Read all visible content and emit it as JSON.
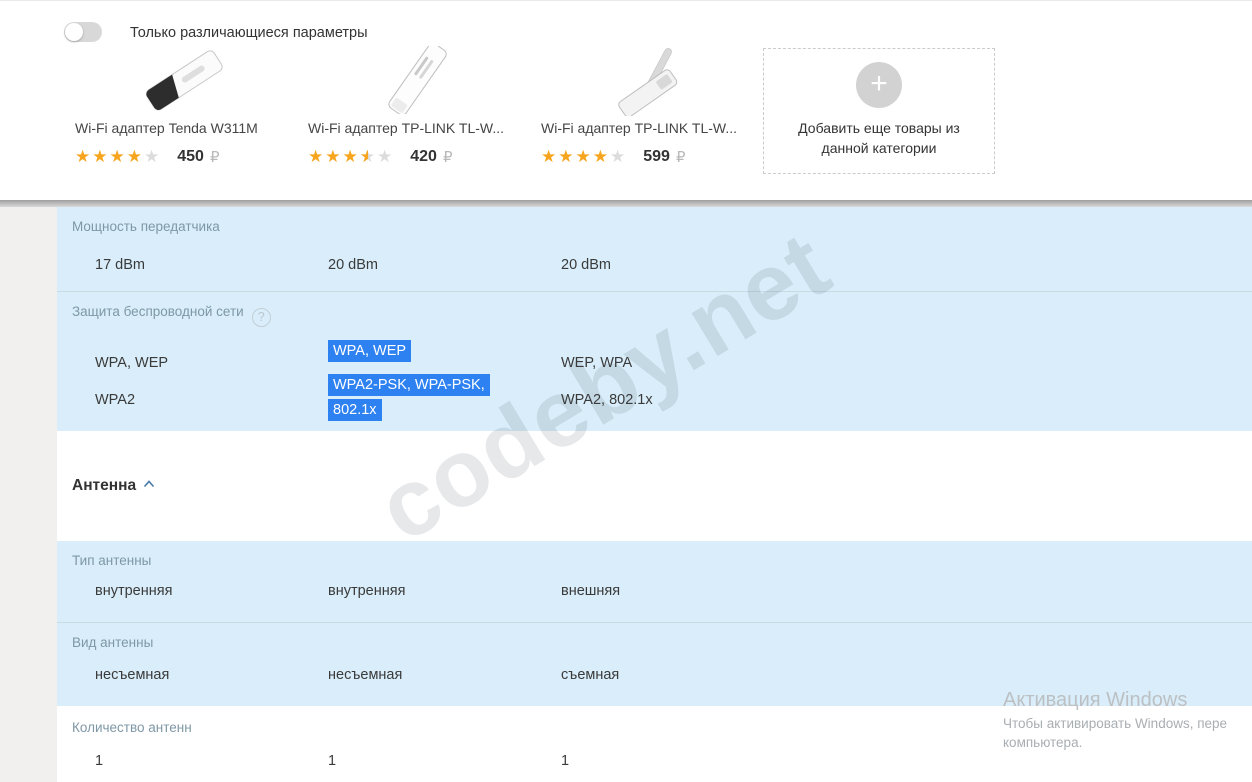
{
  "header": {
    "toggle_label": "Только различающиеся параметры",
    "products": [
      {
        "name": "Wi-Fi адаптер Tenda W311M",
        "rating": 4,
        "price": "450",
        "currency": "₽"
      },
      {
        "name": "Wi-Fi адаптер TP-LINK TL-W...",
        "rating": 3.5,
        "price": "420",
        "currency": "₽"
      },
      {
        "name": "Wi-Fi адаптер TP-LINK TL-W...",
        "rating": 4,
        "price": "599",
        "currency": "₽"
      }
    ],
    "add_more": {
      "label": "Добавить еще товары из данной категории",
      "plus": "+"
    }
  },
  "comparison": {
    "rows": [
      {
        "label": "Мощность передатчика",
        "cells": [
          [
            "17 dBm"
          ],
          [
            "20 dBm"
          ],
          [
            "20 dBm"
          ]
        ]
      },
      {
        "label": "Защита беспроводной сети",
        "help": "?",
        "cells": [
          [
            "WPA, WEP",
            "WPA2"
          ],
          [
            "WPA, WEP",
            "WPA2-PSK, WPA-PSK, 802.1x"
          ],
          [
            "WEP, WPA",
            "WPA2, 802.1x"
          ]
        ],
        "selected_column": 2
      },
      {
        "label": "Тип антенны",
        "cells": [
          [
            "внутренняя"
          ],
          [
            "внутренняя"
          ],
          [
            "внешняя"
          ]
        ]
      },
      {
        "label": "Вид антенны",
        "cells": [
          [
            "несъемная"
          ],
          [
            "несъемная"
          ],
          [
            "съемная"
          ]
        ]
      },
      {
        "label": "Количество антенн",
        "cells": [
          [
            "1"
          ],
          [
            "1"
          ],
          [
            "1"
          ]
        ]
      }
    ],
    "section_header": "Антенна"
  },
  "colors": {
    "row_highlight": "#d9eefa",
    "selection_blue": "#2e81f0",
    "star_gold": "#f7a51f"
  },
  "site_watermark": "codeby.net",
  "windows_watermark": {
    "title": "Активация Windows",
    "line1": "Чтобы активировать Windows, пере",
    "line2": "компьютера."
  }
}
